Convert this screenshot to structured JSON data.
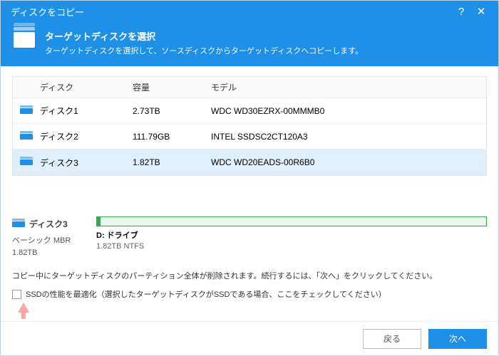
{
  "titlebar": {
    "title": "ディスクをコピー"
  },
  "header": {
    "title": "ターゲットディスクを選択",
    "subtitle": "ターゲットディスクを選択して、ソースディスクからターゲットディスクへコピーします。"
  },
  "table": {
    "headers": {
      "disk": "ディスク",
      "capacity": "容量",
      "model": "モデル"
    },
    "rows": [
      {
        "name": "ディスク1",
        "capacity": "2.73TB",
        "model": "WDC WD30EZRX-00MMMB0",
        "selected": false
      },
      {
        "name": "ディスク2",
        "capacity": "111.79GB",
        "model": "INTEL SSDSC2CT120A3",
        "selected": false
      },
      {
        "name": "ディスク3",
        "capacity": "1.82TB",
        "model": "WDC WD20EADS-00R6B0",
        "selected": true
      }
    ]
  },
  "detail": {
    "disk": "ディスク3",
    "type": "ベーシック MBR",
    "size": "1.82TB",
    "part_label": "D: ドライブ",
    "part_info": "1.82TB NTFS"
  },
  "warning": "コピー中にターゲットディスクのパーティション全体が削除されます。続行するには、「次へ」をクリックしてください。",
  "option_ssd": "SSDの性能を最適化（選択したターゲットディスクがSSDである場合、ここをチェックしてください）",
  "buttons": {
    "back": "戻る",
    "next": "次へ"
  }
}
